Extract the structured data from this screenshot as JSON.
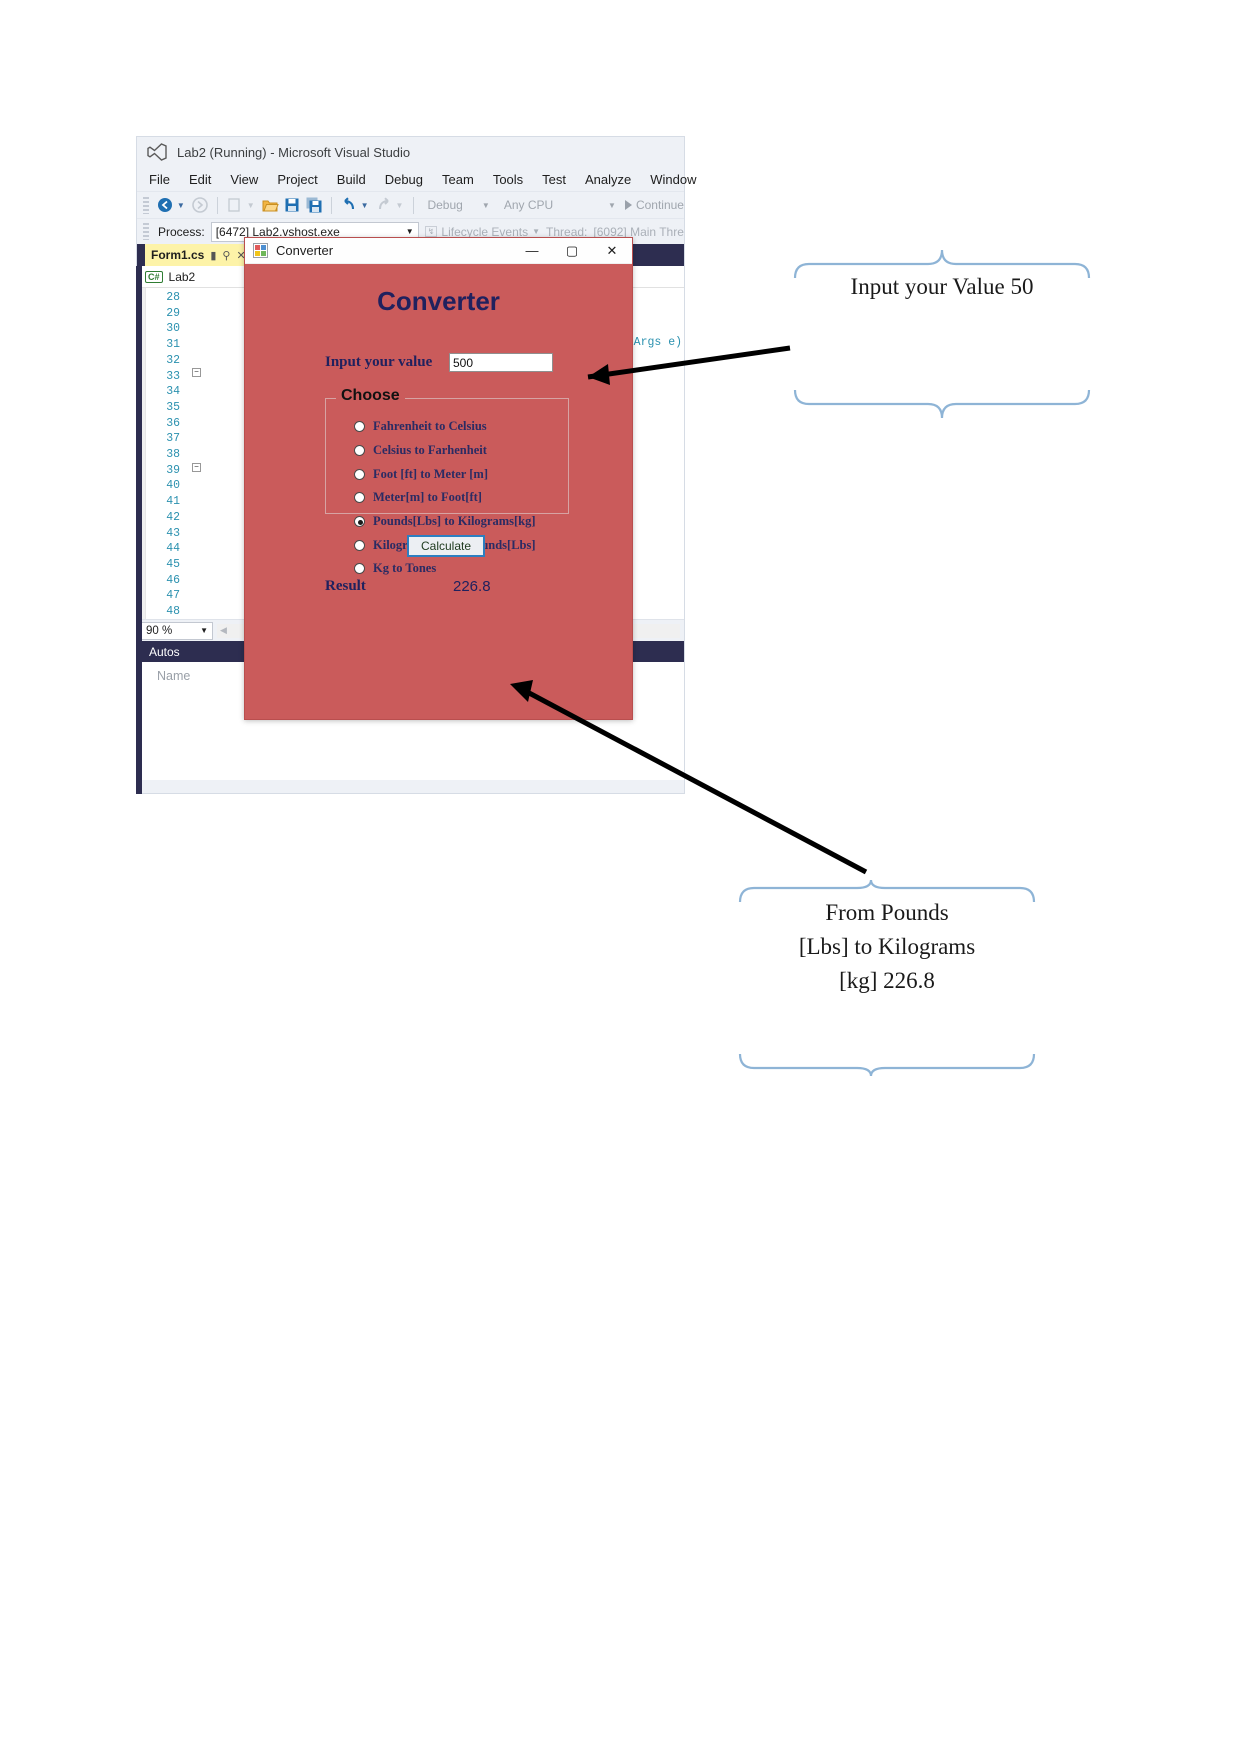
{
  "vs_window": {
    "title": "Lab2 (Running) - Microsoft Visual Studio",
    "logo_icon": "visual-studio-logo-icon",
    "menu": [
      {
        "label": "File",
        "accel": "F"
      },
      {
        "label": "Edit",
        "accel": "E"
      },
      {
        "label": "View",
        "accel": "V"
      },
      {
        "label": "Project",
        "accel": "P"
      },
      {
        "label": "Build",
        "accel": "B"
      },
      {
        "label": "Debug",
        "accel": "D"
      },
      {
        "label": "Team",
        "accel": "m"
      },
      {
        "label": "Tools",
        "accel": "T"
      },
      {
        "label": "Test",
        "accel": "s"
      },
      {
        "label": "Analyze",
        "accel": "n"
      },
      {
        "label": "Window",
        "accel": "W"
      }
    ],
    "toolbar": {
      "back_icon": "navigate-back-icon",
      "forward_icon": "navigate-forward-icon",
      "new_icon": "new-project-icon",
      "open_icon": "open-file-icon",
      "save_icon": "save-icon",
      "save_all_icon": "save-all-icon",
      "undo_icon": "undo-icon",
      "redo_icon": "redo-icon",
      "config_value": "Debug",
      "platform_value": "Any CPU",
      "continue_label": "Continue",
      "continue_icon": "play-continue-icon"
    },
    "process_bar": {
      "label": "Process:",
      "value": "[6472] Lab2.vshost.exe",
      "lifecycle_label": "Lifecycle Events",
      "thread_label": "Thread:",
      "thread_value": "[6092] Main Thre"
    },
    "tab": {
      "label": "Form1.cs",
      "pin_icon": "pin-icon",
      "close_icon": "close-tab-icon",
      "save_icon": "unsaved-dot-icon"
    },
    "nav_bar": {
      "badge": "C#",
      "project": "Lab2"
    },
    "editor": {
      "line_numbers": [
        28,
        29,
        30,
        31,
        32,
        33,
        34,
        35,
        36,
        37,
        38,
        39,
        40,
        41,
        42,
        43,
        44,
        45,
        46,
        47,
        48
      ],
      "code_fragments": [
        {
          "line": 3,
          "text": "tArgs e)"
        },
        {
          "line": 8,
          "text": ")"
        }
      ]
    },
    "zoom_bar": {
      "zoom_value": "90 %"
    },
    "autos_panel": {
      "title": "Autos",
      "column_name": "Name"
    }
  },
  "converter": {
    "window_icon": "winforms-app-icon",
    "window_title": "Converter",
    "minimize_icon": "minimize-icon",
    "maximize_icon": "maximize-icon",
    "close_icon": "close-icon",
    "heading": "Converter",
    "input_label": "Input your value",
    "input_value": "500",
    "group_legend": "Choose",
    "options": [
      {
        "label": "Fahrenheit to Celsius",
        "selected": false
      },
      {
        "label": "Celsius to Farhenheit",
        "selected": false
      },
      {
        "label": "Foot [ft]  to Meter [m]",
        "selected": false
      },
      {
        "label": "Meter[m] to Foot[ft]",
        "selected": false
      },
      {
        "label": "Pounds[Lbs] to Kilograms[kg]",
        "selected": true
      },
      {
        "label": "Kilograms[kg] to Pounds[Lbs]",
        "selected": false
      },
      {
        "label": "Kg to Tones",
        "selected": false
      }
    ],
    "calculate_label": "Calculate",
    "result_label": "Result",
    "result_value": "226.8",
    "accent_color": "#ca5b5b",
    "text_color": "#20215e"
  },
  "annotations": [
    {
      "id": "input-callout",
      "text": "Input your Value 50",
      "brace_color": "#8eb4d6"
    },
    {
      "id": "result-callout",
      "text": "From Pounds [Lbs] to Kilograms [kg] 226.8",
      "brace_color": "#8eb4d6"
    }
  ]
}
